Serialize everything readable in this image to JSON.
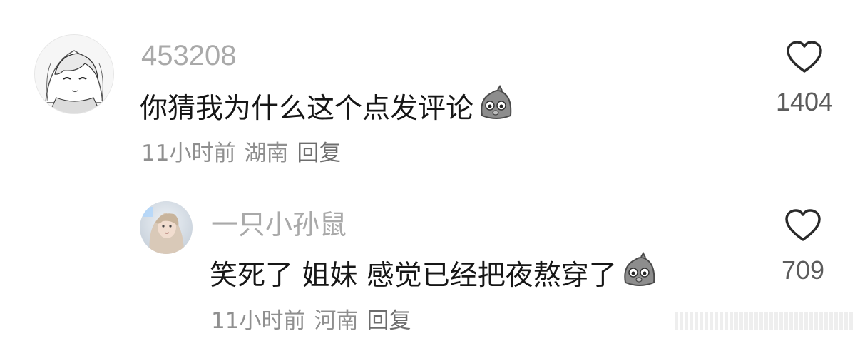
{
  "comments": [
    {
      "username": "453208",
      "text": "你猜我为什么这个点发评论",
      "emoji_icon": "sad-pigeon-emoji",
      "time": "11小时前",
      "location": "湖南",
      "reply_label": "回复",
      "likes": "1404"
    },
    {
      "username": "一只小孙鼠",
      "text": "笑死了 姐妹 感觉已经把夜熬穿了",
      "emoji_icon": "sad-pigeon-emoji",
      "time": "11小时前",
      "location": "河南",
      "reply_label": "回复",
      "likes": "709"
    }
  ],
  "icons": {
    "like": "heart-outline-icon",
    "avatar1": "anime-avatar",
    "avatar2": "photo-avatar"
  },
  "colors": {
    "username": "#a9a9a9",
    "text": "#161616",
    "meta": "#8f8f8f",
    "heart": "#2a2a2a"
  }
}
